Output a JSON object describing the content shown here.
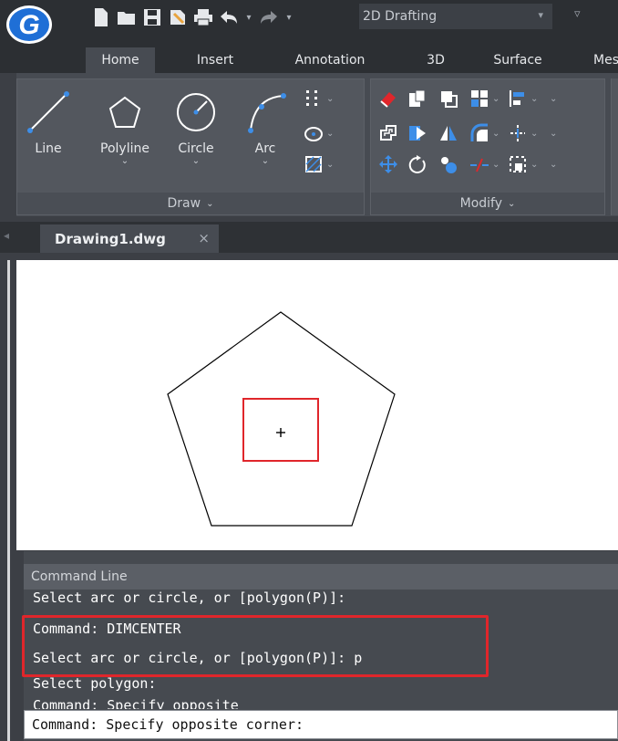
{
  "app": {
    "logo_letter": "G",
    "workspace": "2D Drafting"
  },
  "ribbon_tabs": [
    "Home",
    "Insert",
    "Annotation",
    "3D",
    "Surface",
    "Mes"
  ],
  "panels": {
    "draw": {
      "title": "Draw",
      "tools": [
        "Line",
        "Polyline",
        "Circle",
        "Arc"
      ]
    },
    "modify": {
      "title": "Modify"
    }
  },
  "document_tab": "Drawing1.dwg",
  "command_line": {
    "title": "Command Line",
    "history": [
      "Select arc or circle, or [polygon(P)]:",
      "Command: DIMCENTER",
      "Select arc or circle, or [polygon(P)]: p",
      "Select polygon:",
      "Command: Specify opposite"
    ],
    "current": "Command: Specify opposite corner:"
  },
  "colors": {
    "highlight": "#e0262b",
    "accent": "#3d8ee8",
    "ribbon_bg": "#474b52",
    "titlebar_bg": "#2c2f33"
  },
  "icons": {
    "logo": "gstarcad-logo-icon",
    "close": "close-icon"
  }
}
